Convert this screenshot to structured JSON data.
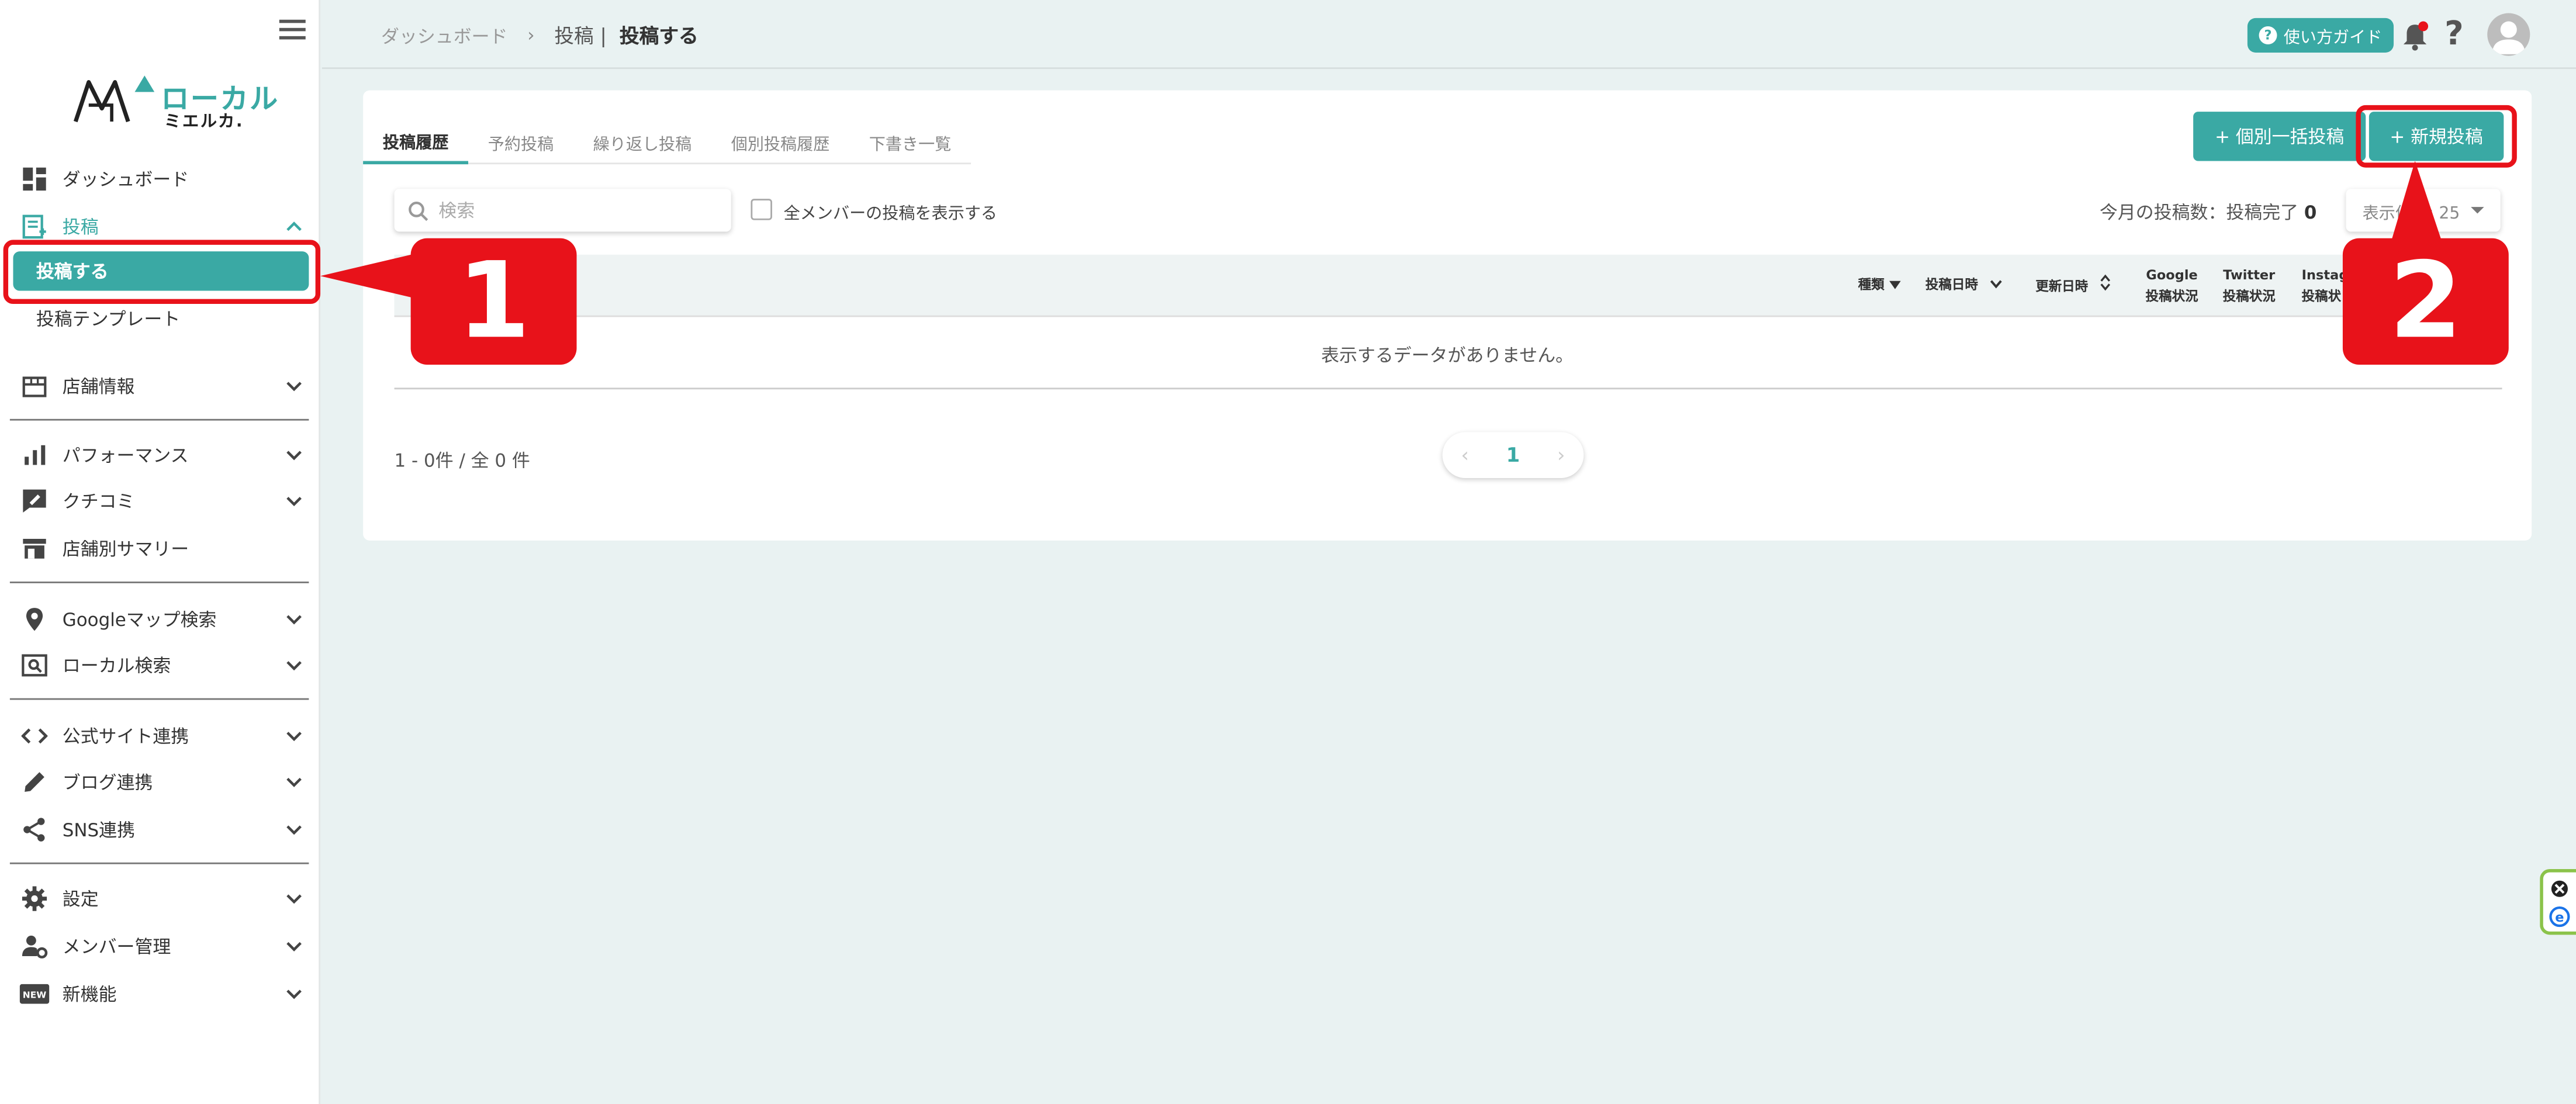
{
  "sidebar": {
    "logo": {
      "brand": "ローカル",
      "sub": "ミエルカ."
    },
    "items": [
      {
        "label": "ダッシュボード",
        "icon": "dashboard-icon"
      },
      {
        "label": "投稿",
        "icon": "post-icon",
        "expanded": true
      },
      {
        "label": "投稿する",
        "selected": true
      },
      {
        "label": "投稿テンプレート"
      },
      {
        "label": "店舗情報",
        "icon": "store-icon"
      },
      {
        "label": "パフォーマンス",
        "icon": "bar-chart-icon"
      },
      {
        "label": "クチコミ",
        "icon": "review-icon"
      },
      {
        "label": "店舗別サマリー",
        "icon": "store-summary-icon"
      },
      {
        "label": "Googleマップ検索",
        "icon": "map-pin-icon"
      },
      {
        "label": "ローカル検索",
        "icon": "local-search-icon"
      },
      {
        "label": "公式サイト連携",
        "icon": "code-icon"
      },
      {
        "label": "ブログ連携",
        "icon": "pencil-icon"
      },
      {
        "label": "SNS連携",
        "icon": "share-icon"
      },
      {
        "label": "設定",
        "icon": "gear-icon"
      },
      {
        "label": "メンバー管理",
        "icon": "member-settings-icon"
      },
      {
        "label": "新機能",
        "icon": "new-badge-icon"
      }
    ]
  },
  "header": {
    "breadcrumb": [
      "ダッシュボード",
      "投稿",
      "投稿する"
    ],
    "guide_label": "使い方ガイド"
  },
  "main": {
    "tabs": [
      "投稿履歴",
      "予約投稿",
      "繰り返し投稿",
      "個別投稿履歴",
      "下書き一覧"
    ],
    "bulk_button": "+ 個別一括投稿",
    "new_button": "+ 新規投稿",
    "search_placeholder": "検索",
    "show_all_label": "全メンバーの投稿を表示する",
    "month_count_label": "今月の投稿数：投稿完了",
    "month_count_value": "0",
    "perpage_label": "表示件数: 25",
    "columns": {
      "type": "種類",
      "posted_at": "投稿日時",
      "updated_at": "更新日時",
      "google": [
        "Google",
        "投稿状況"
      ],
      "twitter": [
        "Twitter",
        "投稿状況"
      ],
      "instagram": [
        "Instag",
        "投稿状"
      ]
    },
    "empty_message": "表示するデータがありません。",
    "range_text": "1 - 0件 / 全 0 件",
    "page": "1"
  },
  "annotations": {
    "callout1": "1",
    "callout2": "2"
  },
  "colors": {
    "accent": "#3aa9a4",
    "annotation": "#e8121a"
  }
}
